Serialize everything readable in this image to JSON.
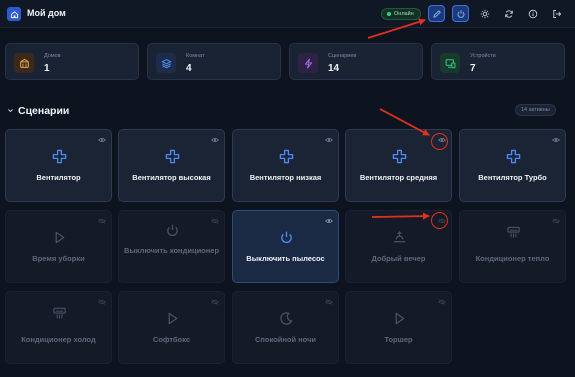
{
  "header": {
    "title": "Мой дом",
    "status": "Онлайн"
  },
  "stats": [
    {
      "label": "Домов",
      "value": "1",
      "icon": "house-icon",
      "color": "#f0a04b"
    },
    {
      "label": "Комнат",
      "value": "4",
      "icon": "layers-icon",
      "color": "#4f8cf5"
    },
    {
      "label": "Сценариев",
      "value": "14",
      "icon": "lightning-icon",
      "color": "#a46cf0"
    },
    {
      "label": "Устройств",
      "value": "7",
      "icon": "devices-icon",
      "color": "#36c98a"
    }
  ],
  "section": {
    "title": "Сценарии",
    "badge": "14 активны"
  },
  "scenarios": [
    {
      "label": "Вентилятор",
      "icon": "fan-icon",
      "visible": true
    },
    {
      "label": "Вентилятор высокая",
      "icon": "fan-icon",
      "visible": true
    },
    {
      "label": "Вентилятор низкая",
      "icon": "fan-icon",
      "visible": true
    },
    {
      "label": "Вентилятор средняя",
      "icon": "fan-icon",
      "visible": true
    },
    {
      "label": "Вентилятор Турбо",
      "icon": "fan-icon",
      "visible": true
    },
    {
      "label": "Время уборки",
      "icon": "play-icon",
      "visible": false
    },
    {
      "label": "Выключить кондиционер",
      "icon": "power-icon",
      "visible": false
    },
    {
      "label": "Выключить пылесос",
      "icon": "power-icon",
      "visible": true
    },
    {
      "label": "Добрый вечер",
      "icon": "sunset-icon",
      "visible": false
    },
    {
      "label": "Кондиционер тепло",
      "icon": "air-conditioner-icon",
      "visible": false
    },
    {
      "label": "Кондиционер холод",
      "icon": "air-conditioner-icon",
      "visible": false
    },
    {
      "label": "Софтбокс",
      "icon": "play-icon",
      "visible": false
    },
    {
      "label": "Спокойной ночи",
      "icon": "moon-icon",
      "visible": false
    },
    {
      "label": "Торшер",
      "icon": "play-icon",
      "visible": false
    }
  ],
  "colors": {
    "accent": "#3b6fe8",
    "annotation": "#e0301e",
    "online": "#35d07f"
  }
}
